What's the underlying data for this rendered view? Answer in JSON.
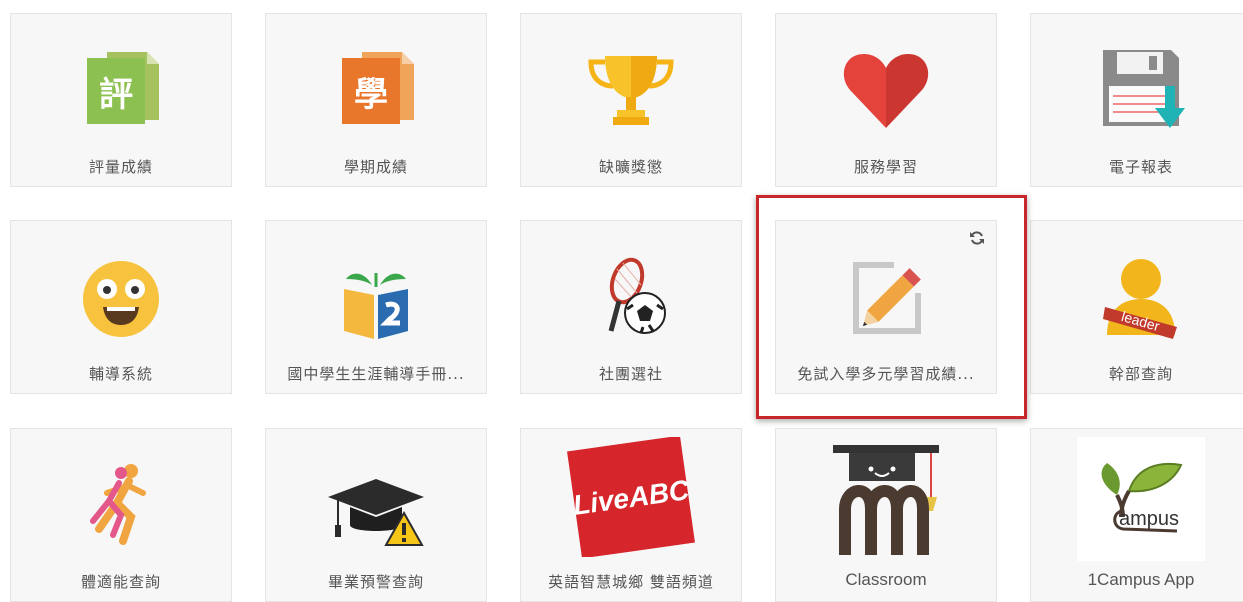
{
  "apps": [
    {
      "label": "評量成績",
      "icon": "grade-document-icon",
      "glyph": "評"
    },
    {
      "label": "學期成績",
      "icon": "semester-document-icon",
      "glyph": "學"
    },
    {
      "label": "缺曠獎懲",
      "icon": "trophy-icon"
    },
    {
      "label": "服務學習",
      "icon": "heart-icon"
    },
    {
      "label": "電子報表",
      "icon": "floppy-download-icon"
    },
    {
      "label": "輔導系統",
      "icon": "smiley-face-icon"
    },
    {
      "label": "國中學生生涯輔導手冊...",
      "icon": "book-sprout-icon"
    },
    {
      "label": "社團選社",
      "icon": "racket-ball-icon"
    },
    {
      "label": "免試入學多元學習成績...",
      "icon": "pencil-edit-icon",
      "refresh_icon": "refresh-icon"
    },
    {
      "label": "幹部查詢",
      "icon": "leader-badge-icon",
      "badge_text": "leader"
    },
    {
      "label": "體適能查詢",
      "icon": "runner-icon"
    },
    {
      "label": "畢業預警查詢",
      "icon": "graduation-cap-warning-icon"
    },
    {
      "label": "英語智慧城鄉 雙語頻道",
      "icon": "liveabc-logo",
      "logo_text": "LiveABC"
    },
    {
      "label": "Classroom",
      "icon": "classroom-mascot-icon"
    },
    {
      "label": "1Campus App",
      "icon": "1campus-logo",
      "logo_text": "ampus"
    }
  ],
  "colors": {
    "highlight_border": "#c9262c",
    "tile_bg": "#f7f7f7"
  }
}
